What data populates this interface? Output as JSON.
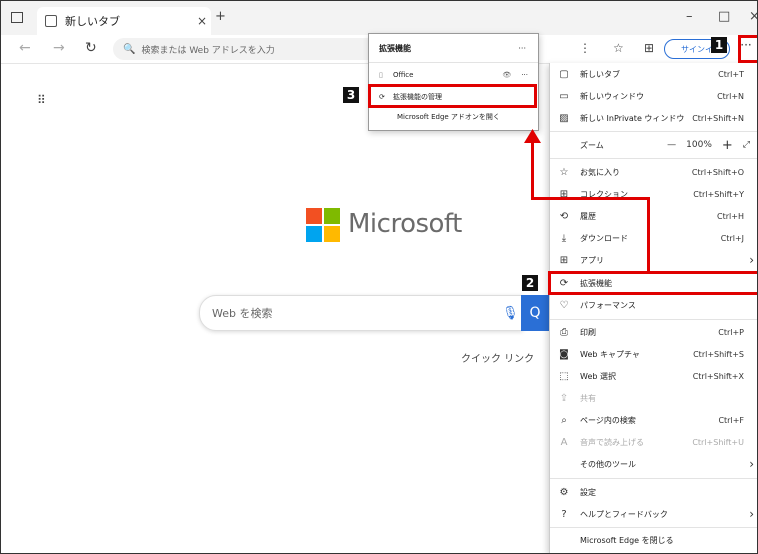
{
  "tab": {
    "title": "新しいタブ",
    "close": "×",
    "new": "+"
  },
  "window": {
    "min": "–",
    "max": "□",
    "close": "×"
  },
  "nav": {
    "back": "←",
    "forward": "→",
    "refresh": "↻"
  },
  "address": {
    "placeholder": "検索または Web アドレスを入力",
    "search_icon": "🔍"
  },
  "toolbar": {
    "signin": "サインイ",
    "more": "···",
    "fav_icon": "☆",
    "collections_icon": "⊞",
    "tab_icon": "⋮"
  },
  "page": {
    "apps_icon": "⠿",
    "brand": "Microsoft",
    "search_placeholder": "Web を検索",
    "mic": "🎙",
    "search_btn": "Q",
    "quick_links": "クイック リンク",
    "logo_colors": [
      "#f25022",
      "#7fba00",
      "#00a4ef",
      "#ffb900"
    ]
  },
  "extensions_popup": {
    "title": "拡張機能",
    "more": "···",
    "items": [
      {
        "label": "Office",
        "icon": "▯",
        "eye": "👁",
        "more": "···"
      },
      {
        "label": "拡張機能の管理",
        "icon": "⟳"
      },
      {
        "label": "Microsoft Edge アドオンを開く"
      }
    ]
  },
  "menu": {
    "items": [
      {
        "icon": "▢",
        "label": "新しいタブ",
        "shortcut": "Ctrl+T"
      },
      {
        "icon": "▭",
        "label": "新しいウィンドウ",
        "shortcut": "Ctrl+N"
      },
      {
        "icon": "▨",
        "label": "新しい InPrivate ウィンドウ",
        "shortcut": "Ctrl+Shift+N"
      },
      {
        "icon": "",
        "label": "ズーム",
        "zoom_minus": "—",
        "zoom_value": "100%",
        "zoom_plus": "+",
        "fullscreen": "⤢"
      },
      {
        "icon": "☆",
        "label": "お気に入り",
        "shortcut": "Ctrl+Shift+O"
      },
      {
        "icon": "⊞",
        "label": "コレクション",
        "shortcut": "Ctrl+Shift+Y"
      },
      {
        "icon": "⟲",
        "label": "履歴",
        "shortcut": "Ctrl+H"
      },
      {
        "icon": "⤓",
        "label": "ダウンロード",
        "shortcut": "Ctrl+J"
      },
      {
        "icon": "⊞",
        "label": "アプリ",
        "shortcut": "›"
      },
      {
        "icon": "⟳",
        "label": "拡張機能",
        "shortcut": ""
      },
      {
        "icon": "♡",
        "label": "パフォーマンス",
        "shortcut": ""
      },
      {
        "icon": "⎙",
        "label": "印刷",
        "shortcut": "Ctrl+P"
      },
      {
        "icon": "◙",
        "label": "Web キャプチャ",
        "shortcut": "Ctrl+Shift+S"
      },
      {
        "icon": "⬚",
        "label": "Web 選択",
        "shortcut": "Ctrl+Shift+X"
      },
      {
        "icon": "⇪",
        "label": "共有",
        "shortcut": ""
      },
      {
        "icon": "⌕",
        "label": "ページ内の検索",
        "shortcut": "Ctrl+F"
      },
      {
        "icon": "A",
        "label": "音声で読み上げる",
        "shortcut": "Ctrl+Shift+U"
      },
      {
        "icon": "",
        "label": "その他のツール",
        "shortcut": "›"
      },
      {
        "icon": "⚙",
        "label": "設定",
        "shortcut": ""
      },
      {
        "icon": "?",
        "label": "ヘルプとフィードバック",
        "shortcut": "›"
      },
      {
        "icon": "",
        "label": "Microsoft Edge を閉じる",
        "shortcut": ""
      }
    ]
  },
  "annotations": {
    "step1": "1",
    "step2": "2",
    "step3": "3",
    "highlight_color": "#e00000"
  }
}
